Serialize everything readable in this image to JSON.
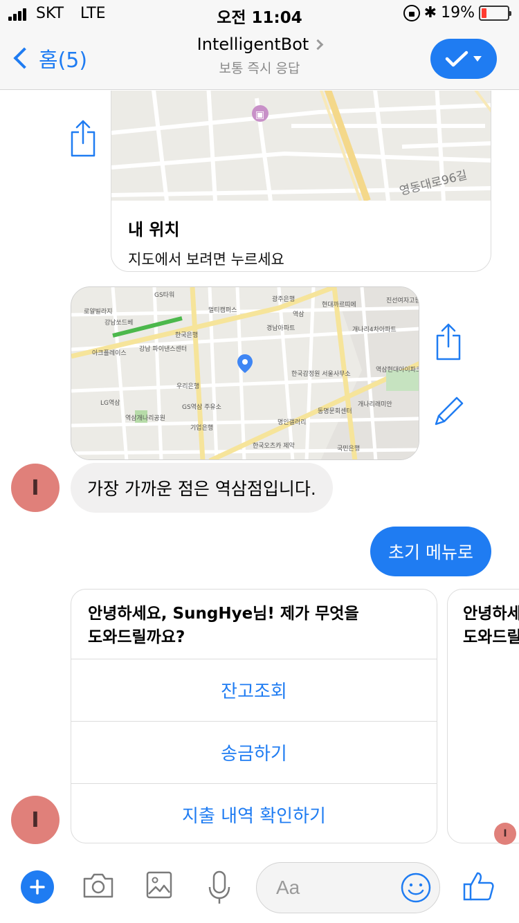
{
  "status_bar": {
    "carrier": "SKT",
    "network": "LTE",
    "time": "오전 11:04",
    "bluetooth": "✱",
    "battery_percent": "19%",
    "battery_level": 0.19,
    "battery_color": "#ff3b30"
  },
  "header": {
    "back_label": "홈(5)",
    "title": "IntelligentBot",
    "subtitle": "보통 즉시 응답"
  },
  "location_card": {
    "title": "내 위치",
    "description": "지도에서 보려면 누르세요",
    "map_label": "영동대로96길"
  },
  "map_image": {
    "labels": [
      "GS타워",
      "광주은행",
      "로얄빌라지",
      "한국은행",
      "역삼",
      "현대까르띠에",
      "강남쏘드베",
      "멀티캠퍼스",
      "경남아파트",
      "개나리4차아파트",
      "아크플레이스",
      "강남 파이낸스센터",
      "우리은행",
      "한국감정원 서울사무소",
      "역삼현대아이파크",
      "GS역삼 주유소",
      "기업은행",
      "명인갤러리",
      "동명문회센터",
      "개나리래미안",
      "역삼개나리공원",
      "한국오츠카 제약",
      "국민은행",
      "진선여자고등학교",
      "LG역삼"
    ]
  },
  "bot_message": {
    "avatar_letter": "I",
    "text": "가장 가까운 점은 역삼점입니다."
  },
  "user_message": {
    "text": "초기 메뉴로"
  },
  "menu_cards": [
    {
      "title_line1": "안녕하세요, SungHye님! 제가 무엇을",
      "title_line2": "도와드릴까요?",
      "buttons": [
        "잔고조회",
        "송금하기",
        "지출 내역 확인하기"
      ]
    },
    {
      "title_line1": "안녕하세",
      "title_line2": "도와드릴"
    }
  ],
  "composer": {
    "placeholder": "Aa"
  },
  "colors": {
    "accent": "#1f7cf2",
    "avatar": "#e0807a",
    "bot_bubble": "#f1f0f0"
  }
}
